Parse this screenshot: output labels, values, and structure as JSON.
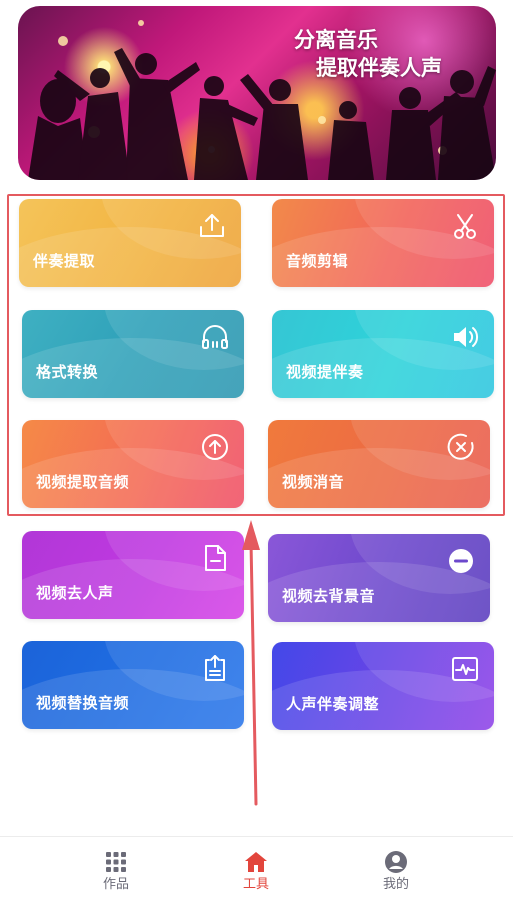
{
  "banner": {
    "title_line1": "分离音乐",
    "title_line2": "提取伴奏人声"
  },
  "tools": [
    {
      "label": "伴奏提取",
      "icon": "upload-icon"
    },
    {
      "label": "音频剪辑",
      "icon": "scissors-icon"
    },
    {
      "label": "格式转换",
      "icon": "headphones-icon"
    },
    {
      "label": "视频提伴奏",
      "icon": "speaker-icon"
    },
    {
      "label": "视频提取音频",
      "icon": "arrow-up-circle-icon"
    },
    {
      "label": "视频消音",
      "icon": "close-circle-icon"
    },
    {
      "label": "视频去人声",
      "icon": "document-minus-icon"
    },
    {
      "label": "视频去背景音",
      "icon": "minus-circle-icon"
    },
    {
      "label": "视频替换音频",
      "icon": "clipboard-upload-icon"
    },
    {
      "label": "人声伴奏调整",
      "icon": "waveform-icon"
    }
  ],
  "colors": {
    "highlight_border": "#e45a5f",
    "nav_active": "#e2453c",
    "nav_inactive": "#6b6b78"
  },
  "bottom_nav": {
    "works": "作品",
    "tools": "工具",
    "mine": "我的",
    "active": "tools"
  }
}
